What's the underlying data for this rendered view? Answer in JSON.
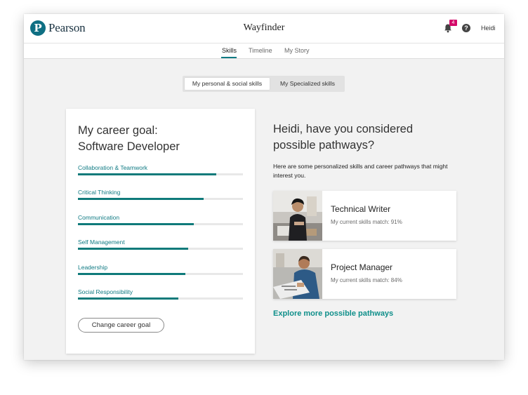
{
  "header": {
    "logo_text": "Pearson",
    "logo_letter": "P",
    "app_title": "Wayfinder",
    "notification_count": "4",
    "help_glyph": "?",
    "user_name": "Heidi"
  },
  "tabs": [
    {
      "label": "Skills",
      "active": true
    },
    {
      "label": "Timeline",
      "active": false
    },
    {
      "label": "My Story",
      "active": false
    }
  ],
  "skill_toggle": [
    {
      "label": "My personal & social skills",
      "active": true
    },
    {
      "label": "My Specialized skills",
      "active": false
    }
  ],
  "goal_card": {
    "title_line1": "My career goal:",
    "title_line2": "Software Developer",
    "skills": [
      {
        "name": "Collaboration & Teamwork",
        "level": 0.84
      },
      {
        "name": "Critical Thinking",
        "level": 0.76
      },
      {
        "name": "Communication",
        "level": 0.7
      },
      {
        "name": "Self Management",
        "level": 0.67
      },
      {
        "name": "Leadership",
        "level": 0.65
      },
      {
        "name": "Social Responsibility",
        "level": 0.61
      }
    ],
    "change_button": "Change career goal"
  },
  "pathways": {
    "heading": "Heidi, have you considered possible pathways?",
    "subtext": "Here are some personalized skills and career pathways that might interest you.",
    "cards": [
      {
        "title": "Technical Writer",
        "match": "My current skills match: 91%"
      },
      {
        "title": "Project Manager",
        "match": "My current skills match: 84%"
      }
    ],
    "explore_link": "Explore more possible pathways"
  },
  "colors": {
    "accent": "#0f7a83",
    "badge": "#d40a6a",
    "background": "#f2f2f2"
  },
  "icons": [
    "bell-icon",
    "help-icon",
    "pearson-logo"
  ]
}
